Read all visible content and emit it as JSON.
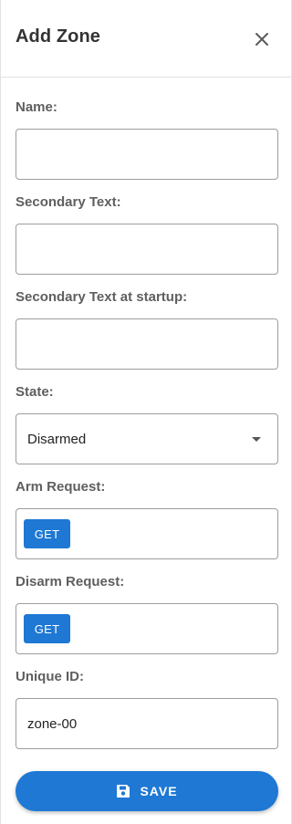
{
  "dialog": {
    "title": "Add Zone",
    "close_icon": "close-icon"
  },
  "form": {
    "name": {
      "label": "Name:",
      "value": ""
    },
    "secondary_text": {
      "label": "Secondary Text:",
      "value": ""
    },
    "secondary_text_startup": {
      "label": "Secondary Text at startup:",
      "value": ""
    },
    "state": {
      "label": "State:",
      "selected": "Disarmed"
    },
    "arm_request": {
      "label": "Arm Request:",
      "method": "GET"
    },
    "disarm_request": {
      "label": "Disarm Request:",
      "method": "GET"
    },
    "unique_id": {
      "label": "Unique ID:",
      "value": "zone-00"
    }
  },
  "actions": {
    "save_label": "SAVE",
    "save_icon": "floppy-disk-icon"
  },
  "colors": {
    "accent": "#1e78d4",
    "label": "#5f5f5f",
    "border": "#9d9d9d"
  }
}
